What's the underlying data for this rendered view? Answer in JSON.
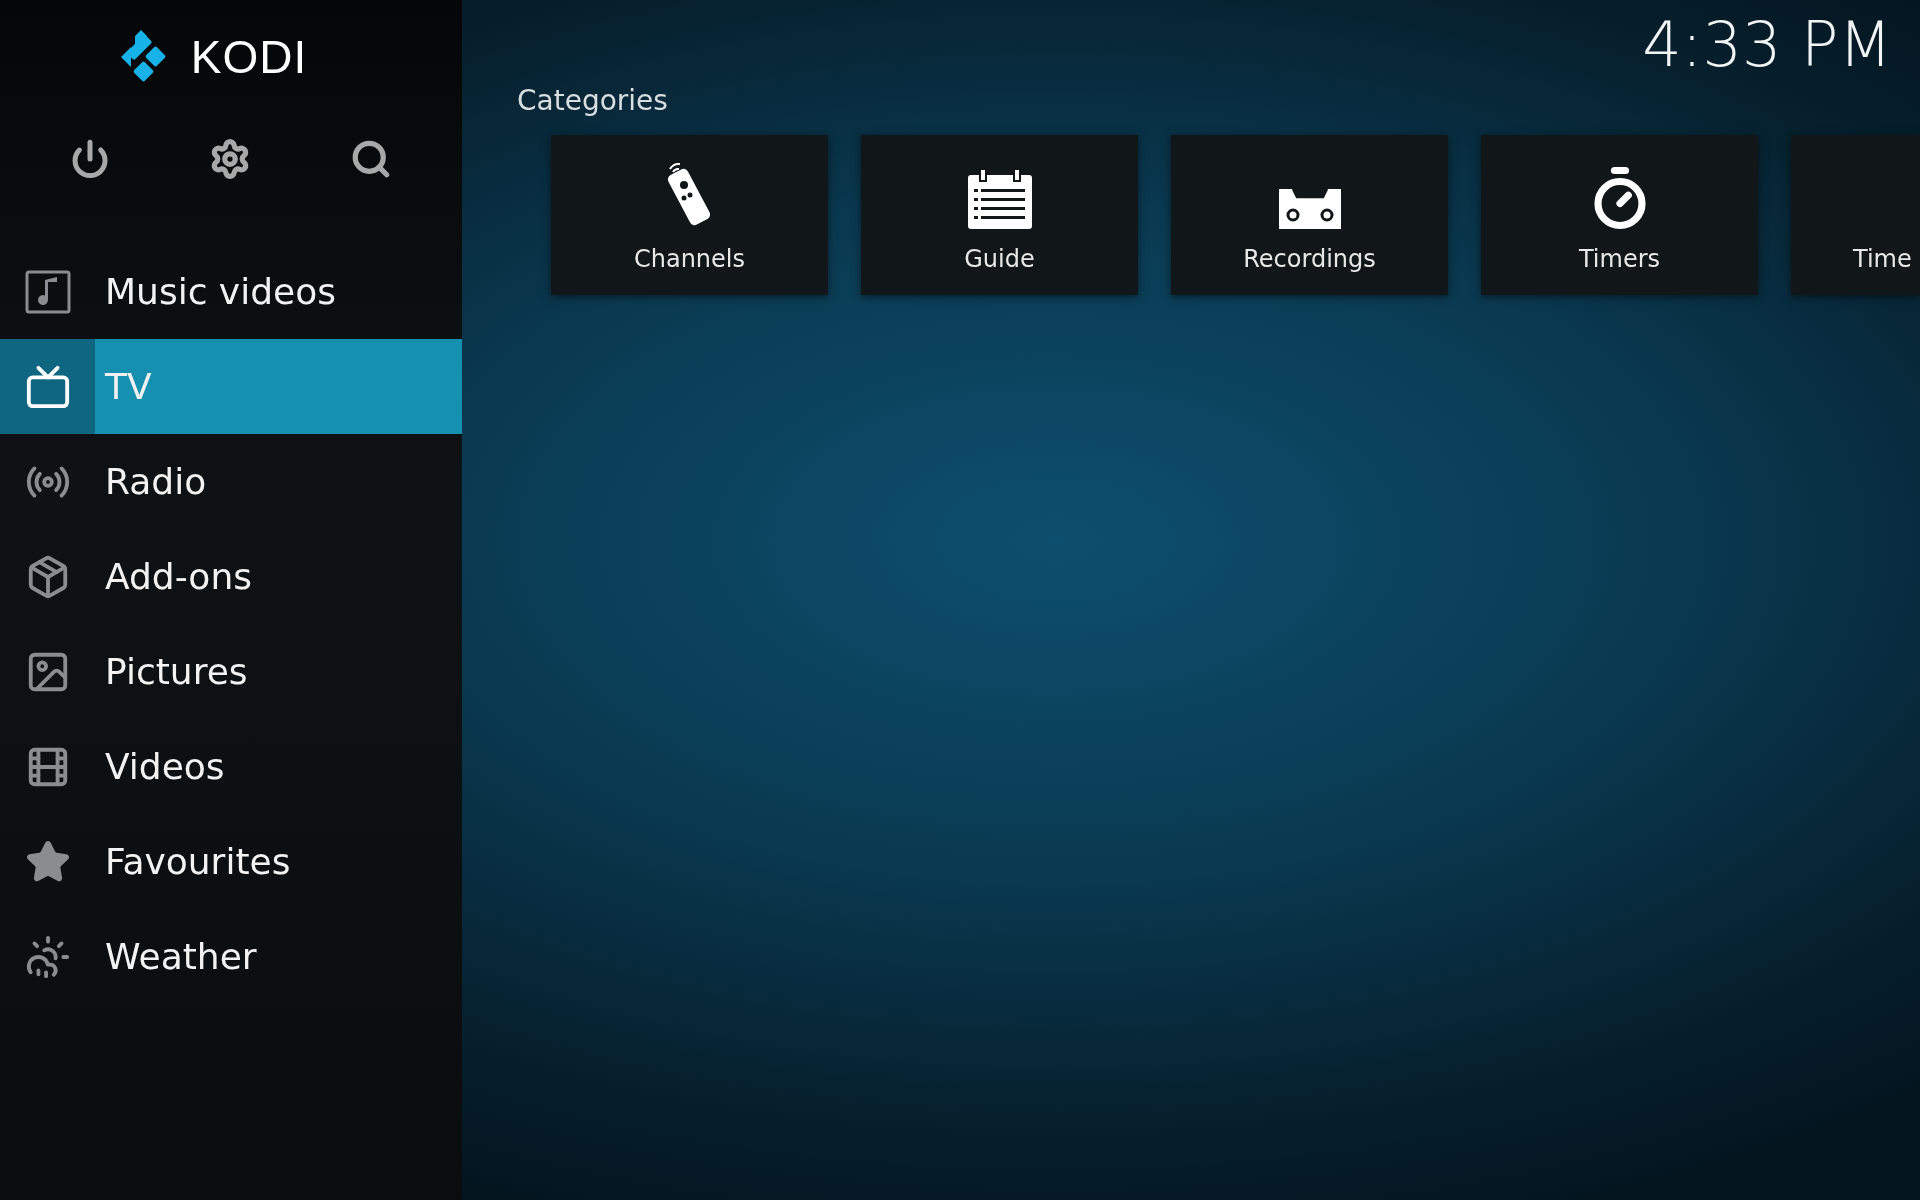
{
  "logo": {
    "text": "KODI"
  },
  "clock": "4:33 PM",
  "top_buttons": [
    {
      "kind": "power"
    },
    {
      "kind": "settings"
    },
    {
      "kind": "search"
    }
  ],
  "sidebar": {
    "items": [
      {
        "label": "Music videos",
        "kind": "musicvideos",
        "selected": false
      },
      {
        "label": "TV",
        "kind": "tv",
        "selected": true
      },
      {
        "label": "Radio",
        "kind": "radio",
        "selected": false
      },
      {
        "label": "Add-ons",
        "kind": "addons",
        "selected": false
      },
      {
        "label": "Pictures",
        "kind": "pictures",
        "selected": false
      },
      {
        "label": "Videos",
        "kind": "videos",
        "selected": false
      },
      {
        "label": "Favourites",
        "kind": "favourites",
        "selected": false
      },
      {
        "label": "Weather",
        "kind": "weather",
        "selected": false
      }
    ]
  },
  "categories": {
    "title": "Categories",
    "tiles": [
      {
        "label": "Channels",
        "kind": "channels"
      },
      {
        "label": "Guide",
        "kind": "guide"
      },
      {
        "label": "Recordings",
        "kind": "recordings"
      },
      {
        "label": "Timers",
        "kind": "timers"
      },
      {
        "label": "Time",
        "kind": "partial"
      }
    ]
  }
}
